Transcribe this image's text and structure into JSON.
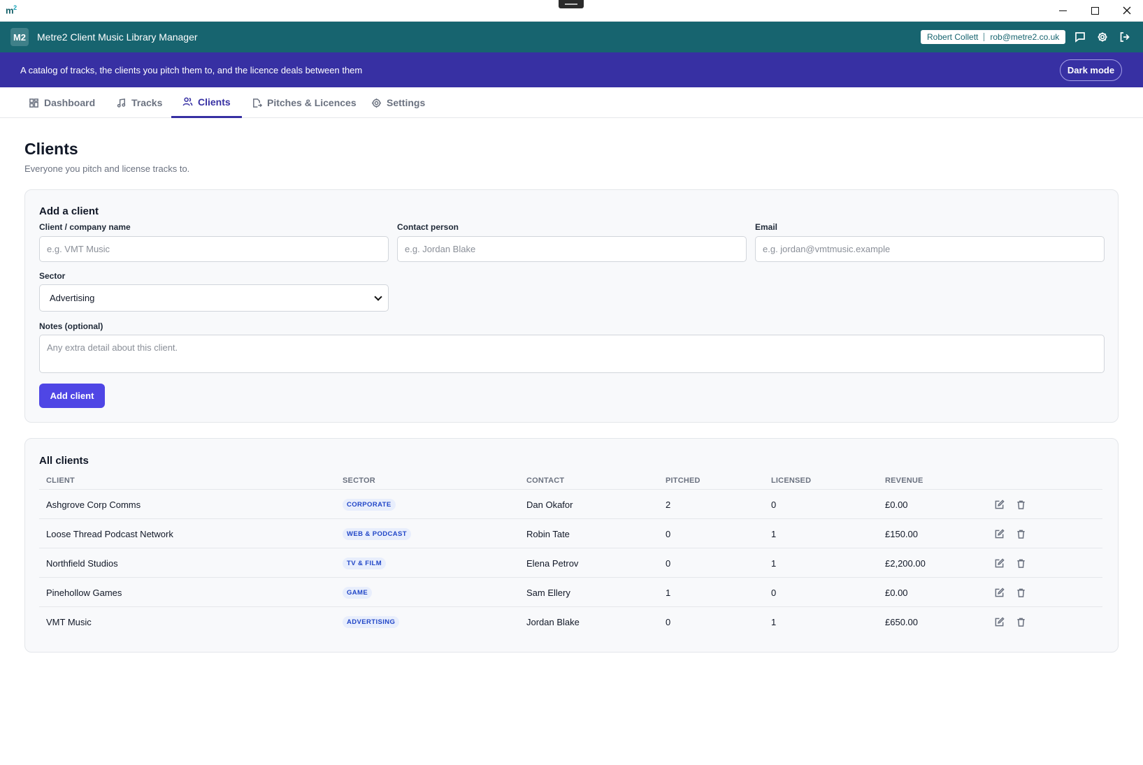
{
  "window": {
    "logo": "m",
    "logo_sup": "2"
  },
  "header": {
    "badge": "M2",
    "title": "Metre2 Client Music Library Manager",
    "user_name": "Robert Collett",
    "user_email": "rob@metre2.co.uk"
  },
  "banner": {
    "text": "A catalog of tracks, the clients you pitch them to, and the licence deals between them",
    "dark_mode_label": "Dark mode"
  },
  "tabs": [
    {
      "label": "Dashboard",
      "icon": "grid-icon",
      "active": false
    },
    {
      "label": "Tracks",
      "icon": "music-note-icon",
      "active": false
    },
    {
      "label": "Clients",
      "icon": "users-icon",
      "active": true
    },
    {
      "label": "Pitches & Licences",
      "icon": "send-document-icon",
      "active": false
    },
    {
      "label": "Settings",
      "icon": "gear-icon",
      "active": false
    }
  ],
  "page": {
    "title": "Clients",
    "subtitle": "Everyone you pitch and license tracks to."
  },
  "add_form": {
    "heading": "Add a client",
    "name_label": "Client / company name",
    "name_placeholder": "e.g. VMT Music",
    "contact_label": "Contact person",
    "contact_placeholder": "e.g. Jordan Blake",
    "email_label": "Email",
    "email_placeholder": "e.g. jordan@vmtmusic.example",
    "sector_label": "Sector",
    "sector_value": "Advertising",
    "notes_label": "Notes (optional)",
    "notes_placeholder": "Any extra detail about this client.",
    "submit_label": "Add client"
  },
  "clients_table": {
    "heading": "All clients",
    "columns": [
      "CLIENT",
      "SECTOR",
      "CONTACT",
      "PITCHED",
      "LICENSED",
      "REVENUE"
    ],
    "rows": [
      {
        "client": "Ashgrove Corp Comms",
        "sector": "CORPORATE",
        "contact": "Dan Okafor",
        "pitched": "2",
        "licensed": "0",
        "revenue": "£0.00"
      },
      {
        "client": "Loose Thread Podcast Network",
        "sector": "WEB & PODCAST",
        "contact": "Robin Tate",
        "pitched": "0",
        "licensed": "1",
        "revenue": "£150.00"
      },
      {
        "client": "Northfield Studios",
        "sector": "TV & FILM",
        "contact": "Elena Petrov",
        "pitched": "0",
        "licensed": "1",
        "revenue": "£2,200.00"
      },
      {
        "client": "Pinehollow Games",
        "sector": "GAME",
        "contact": "Sam Ellery",
        "pitched": "1",
        "licensed": "0",
        "revenue": "£0.00"
      },
      {
        "client": "VMT Music",
        "sector": "ADVERTISING",
        "contact": "Jordan Blake",
        "pitched": "0",
        "licensed": "1",
        "revenue": "£650.00"
      }
    ]
  },
  "colors": {
    "header": "#17646f",
    "banner": "#3730a3",
    "accent": "#4f46e5",
    "badge_bg": "#e8eefc",
    "badge_text": "#2146c7"
  }
}
